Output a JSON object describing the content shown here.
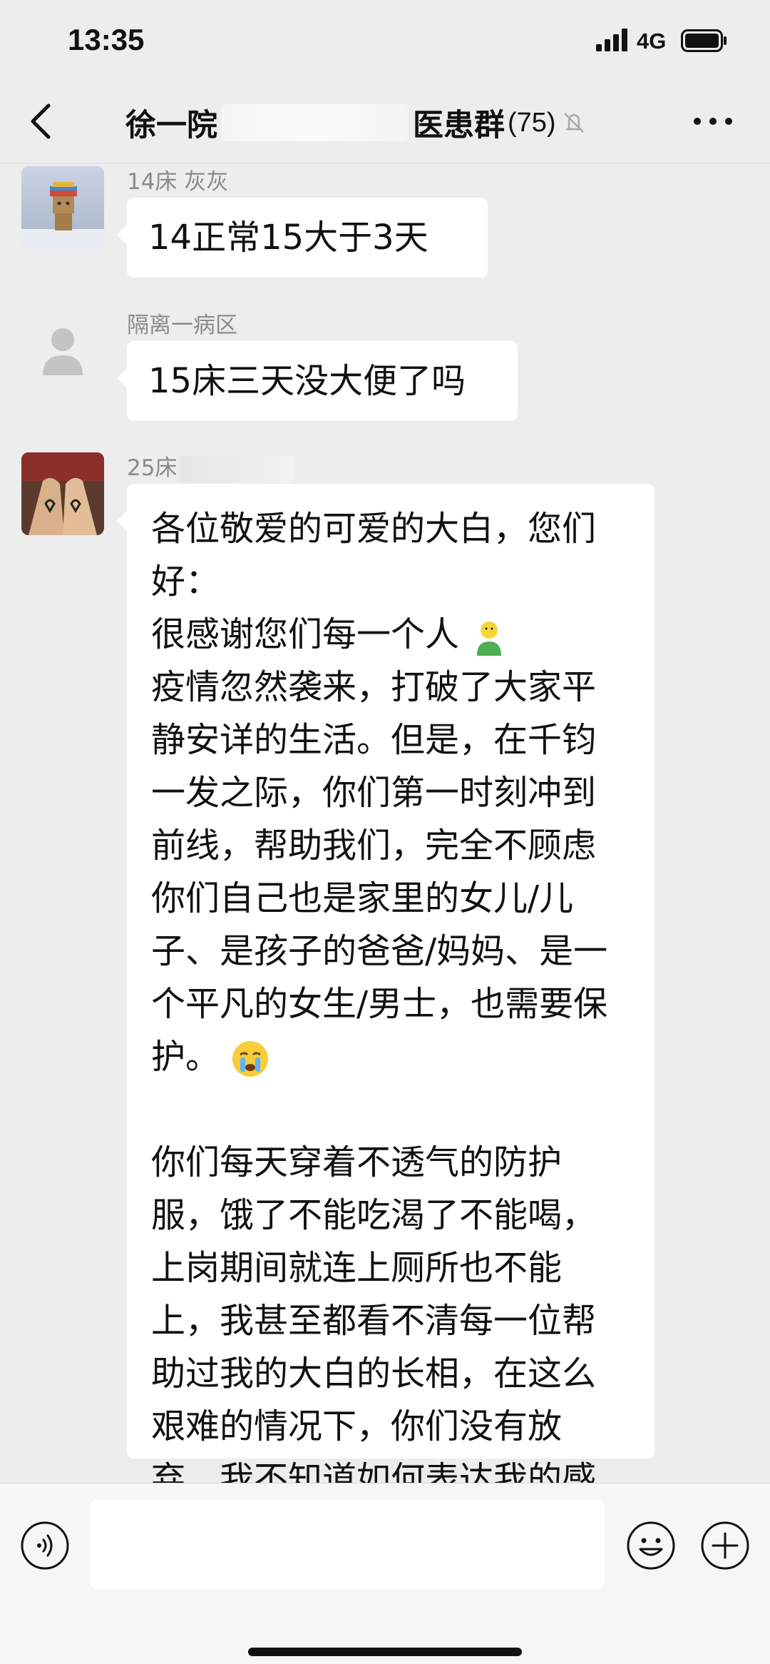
{
  "status_bar": {
    "time": "13:35",
    "network": "4G",
    "icons": [
      "signal-icon",
      "battery-icon"
    ]
  },
  "header": {
    "title_prefix": "徐一院",
    "title_suffix": "医患群",
    "member_count": "(75)",
    "icons": [
      "back-icon",
      "mute-icon",
      "more-icon"
    ]
  },
  "messages": [
    {
      "sender": "14床  灰灰",
      "avatar": "doll-avatar",
      "text": "14正常15大于3天"
    },
    {
      "sender": "隔离一病区",
      "avatar": "default-avatar",
      "text": "15床三天没大便了吗"
    },
    {
      "sender": "25床",
      "avatar": "hearts-avatar",
      "paragraph1": "各位敬爱的可爱的大白，您们好：",
      "line2": "很感谢您们每一个人",
      "paragraph2": "疫情忽然袭来，打破了大家平静安详的生活。但是，在千钧一发之际，你们第一时刻冲到前线，帮助我们，完全不顾虑你们自己也是家里的女儿/儿子、是孩子的爸爸/妈妈、是一个平凡的女生/男士，也需要保护。",
      "paragraph3": "你们每天穿着不透气的防护服，饿了不能吃渴了不能喝，上岗期间就连上厕所也不能上，我甚至都看不清每一位帮助过我的大白的长相，在这么艰难的情况下，你们没有放弃，我不知道如何表达我的感谢、但是还是说一句非常感谢大家，你们辛苦了！",
      "emojis": [
        "person-emoji",
        "crying-emoji"
      ]
    }
  ],
  "input_bar": {
    "input_value": "",
    "icons": [
      "voice-icon",
      "emoji-icon",
      "plus-icon"
    ]
  },
  "colors": {
    "background": "#ededed",
    "bubble": "#ffffff",
    "sender": "#8a8a8a"
  }
}
